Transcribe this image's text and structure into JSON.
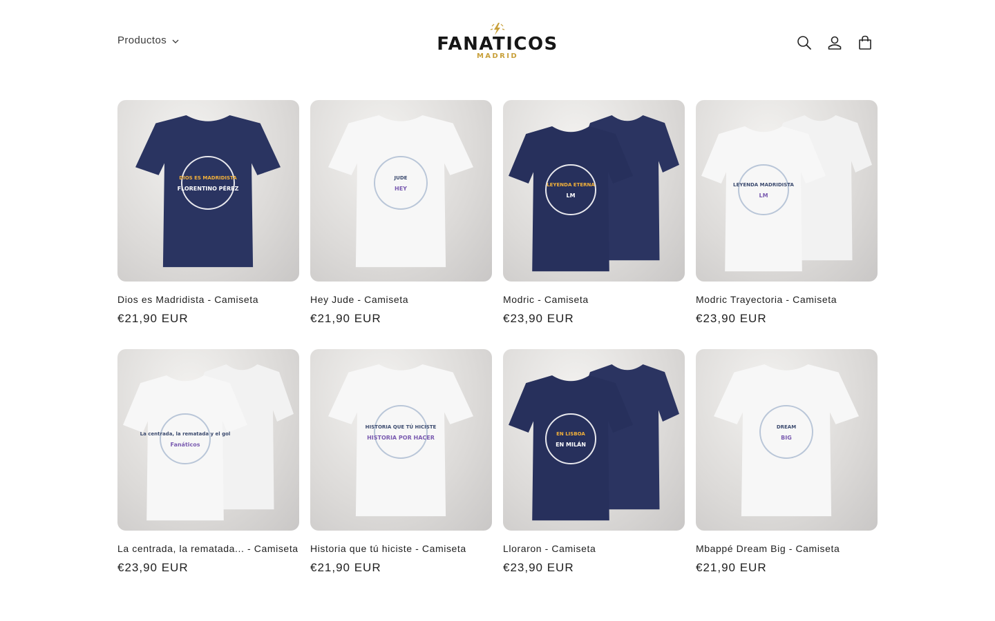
{
  "header": {
    "menu_label": "Productos",
    "logo": {
      "main": "FANATICOS",
      "sub": "MADRID",
      "accent": "#c8a03a"
    },
    "icons": [
      "search-icon",
      "account-icon",
      "cart-icon"
    ]
  },
  "products": [
    {
      "title": "Dios es Madridista - Camiseta",
      "price": "€21,90 EUR",
      "shirt": "#2a3461",
      "back": "",
      "art_text": "DIOS ES MADRIDISTA",
      "art_sub": "FLORENTINO PÉREZ"
    },
    {
      "title": "Hey Jude - Camiseta",
      "price": "€21,90 EUR",
      "shirt": "#f7f7f7",
      "back": "",
      "art_text": "JUDE",
      "art_sub": "HEY"
    },
    {
      "title": "Modric - Camiseta",
      "price": "€23,90 EUR",
      "shirt": "#27305c",
      "back": "#2b3461",
      "art_text": "LEYENDA ETERNA",
      "art_sub": "LM"
    },
    {
      "title": "Modric Trayectoria - Camiseta",
      "price": "€23,90 EUR",
      "shirt": "#f7f7f7",
      "back": "#f2f2f2",
      "art_text": "LEYENDA MADRIDISTA",
      "art_sub": "LM"
    },
    {
      "title": "La centrada, la rematada... - Camiseta",
      "price": "€23,90 EUR",
      "shirt": "#f7f7f7",
      "back": "#f2f2f2",
      "art_text": "La centrada, la rematada y el gol",
      "art_sub": "Fanáticos"
    },
    {
      "title": "Historia que tú hiciste - Camiseta",
      "price": "€21,90 EUR",
      "shirt": "#f7f7f7",
      "back": "",
      "art_text": "HISTORIA QUE TÚ HICISTE",
      "art_sub": "HISTORIA POR HACER"
    },
    {
      "title": "Lloraron - Camiseta",
      "price": "€23,90 EUR",
      "shirt": "#27305c",
      "back": "#2b3461",
      "art_text": "EN LISBOA",
      "art_sub": "EN MILÁN"
    },
    {
      "title": "Mbappé Dream Big - Camiseta",
      "price": "€21,90 EUR",
      "shirt": "#f7f7f7",
      "back": "",
      "art_text": "DREAM",
      "art_sub": "BIG"
    }
  ]
}
